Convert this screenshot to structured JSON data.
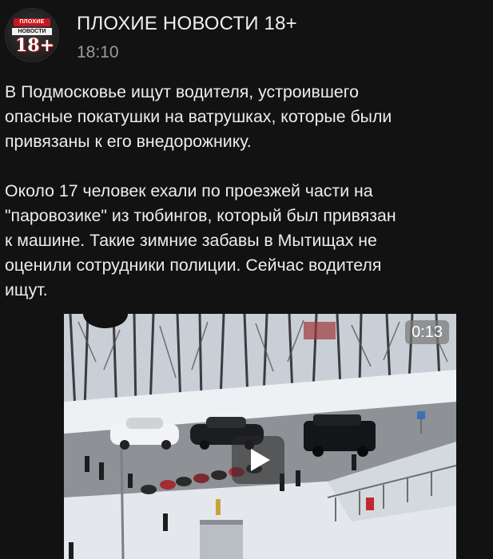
{
  "channel": {
    "name": "ПЛОХИЕ НОВОСТИ 18+",
    "avatar_top": "ПЛОХИЕ",
    "avatar_mid": "НОВОСТИ",
    "avatar_age": "18+"
  },
  "post": {
    "time": "18:10",
    "paragraph1_lines": [
      "В Подмосковье ищут водителя, устроившего",
      "опасные покатушки на ватрушках, которые были",
      "привязаны к его внедорожнику."
    ],
    "paragraph2_lines": [
      "Около 17 человек ехали по проезжей части на",
      "\"паровозике\" из тюбингов, который был привязан",
      "к машине. Такие зимние забавы в Мытищах не",
      "оценили сотрудники полиции. Сейчас водителя",
      "ищут."
    ]
  },
  "video": {
    "duration": "0:13",
    "play_icon": "play-icon",
    "colors": {
      "snow": "#e9edf1",
      "road": "#8b8e93",
      "overlay": "#2a2a2a"
    }
  }
}
